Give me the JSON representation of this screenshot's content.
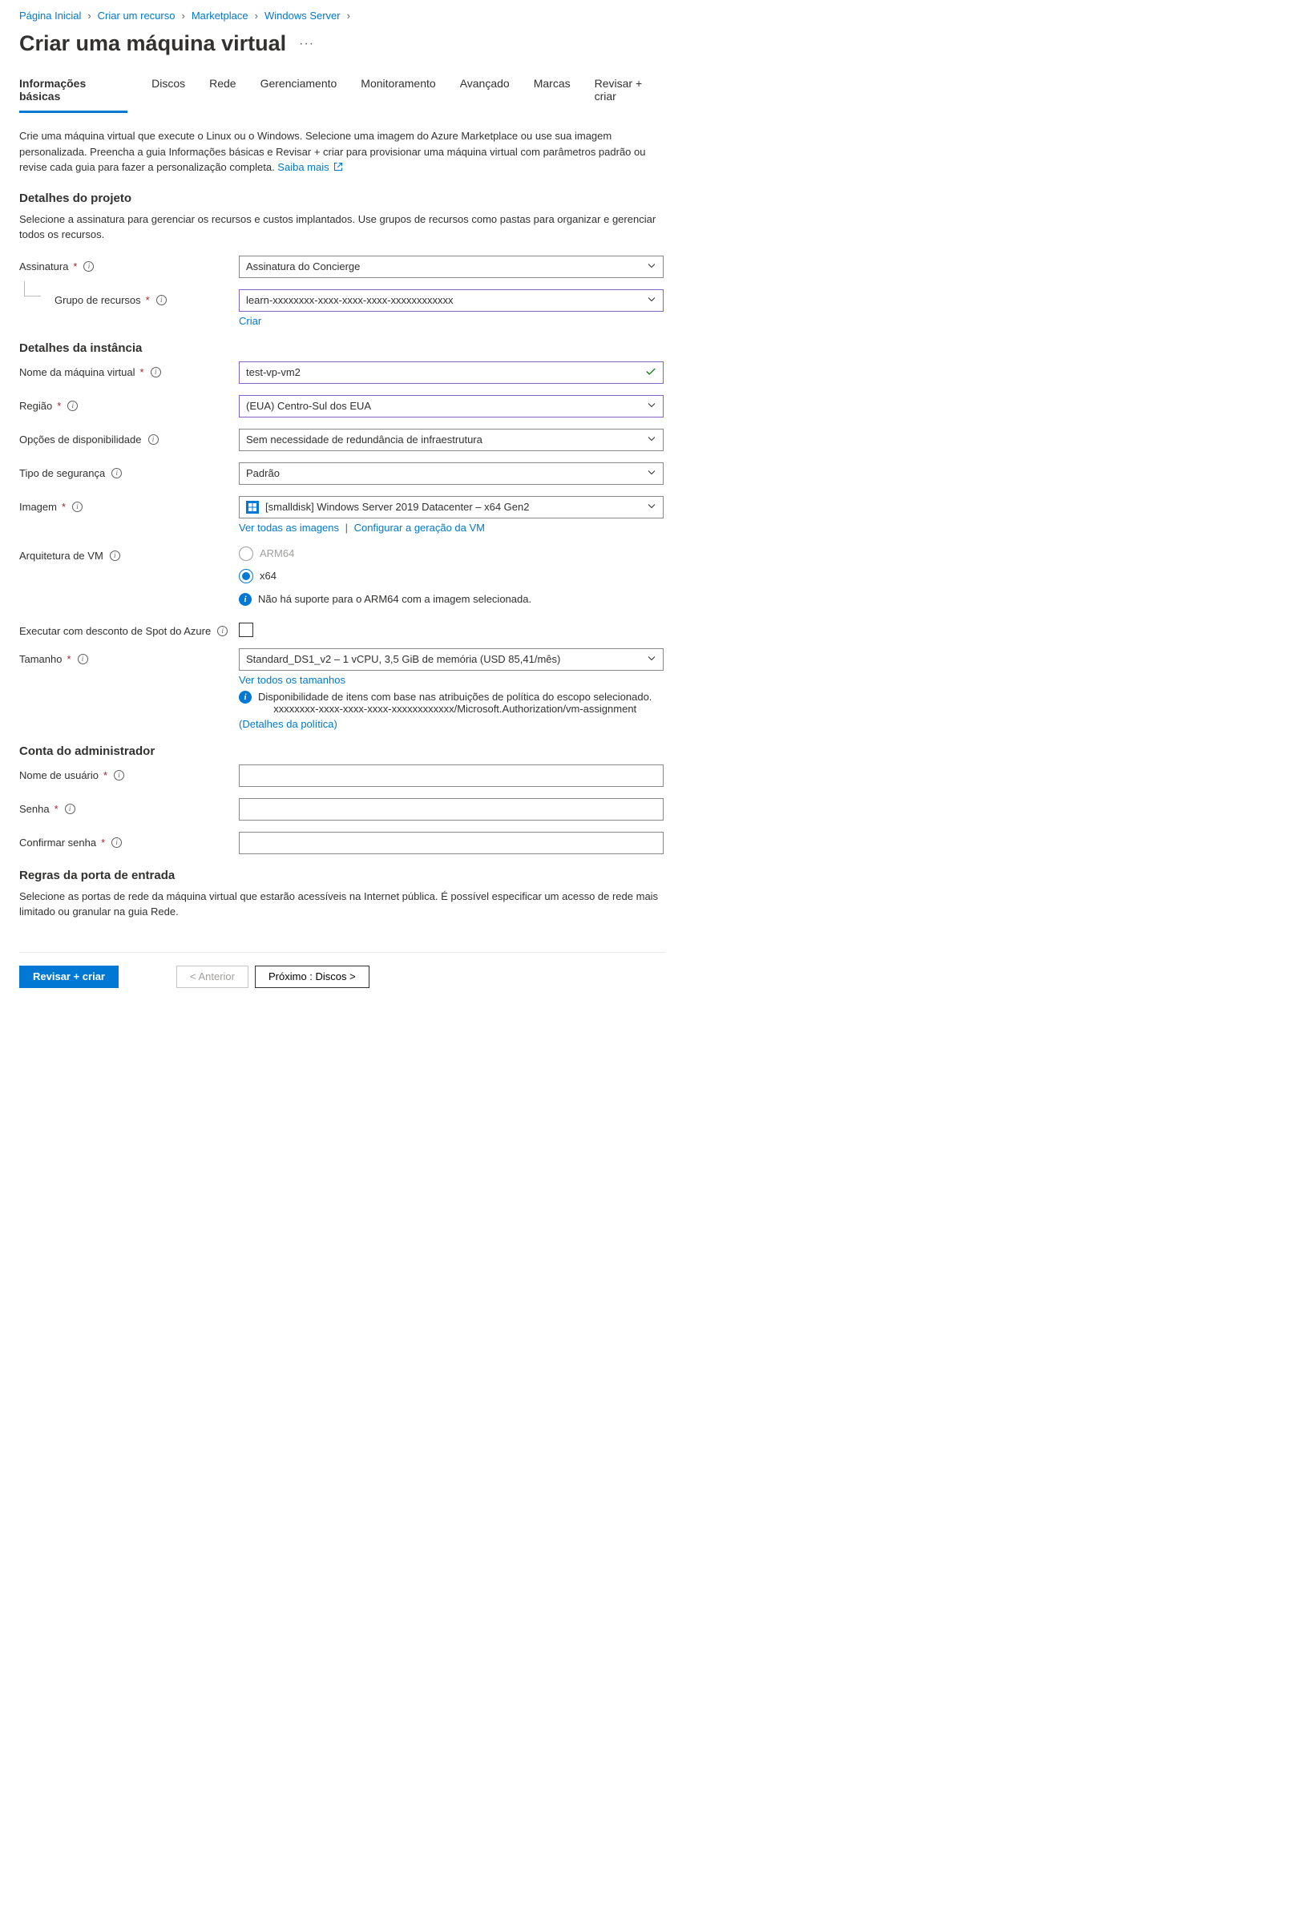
{
  "breadcrumbs": {
    "home": "Página Inicial",
    "create": "Criar um recurso",
    "marketplace": "Marketplace",
    "windows": "Windows Server"
  },
  "title": "Criar uma máquina virtual",
  "tabs": {
    "basics": "Informações básicas",
    "disks": "Discos",
    "network": "Rede",
    "mgmt": "Gerenciamento",
    "monitor": "Monitoramento",
    "advanced": "Avançado",
    "tags": "Marcas",
    "review": "Revisar + criar"
  },
  "intro": "Crie uma máquina virtual que execute o Linux ou o Windows. Selecione uma imagem do Azure Marketplace ou use sua imagem personalizada. Preencha a guia Informações básicas e Revisar + criar para provisionar uma máquina virtual com parâmetros padrão ou revise cada guia para fazer a personalização completa. ",
  "learn_more": "Saiba mais",
  "project": {
    "heading": "Detalhes do projeto",
    "desc": "Selecione a assinatura para gerenciar os recursos e custos implantados. Use grupos de recursos como pastas para organizar e gerenciar todos os recursos.",
    "subscription_label": "Assinatura",
    "subscription_value": "Assinatura do Concierge",
    "rg_label": "Grupo de recursos",
    "rg_value": "learn-xxxxxxxx-xxxx-xxxx-xxxx-xxxxxxxxxxxx",
    "rg_create": "Criar"
  },
  "instance": {
    "heading": "Detalhes da instância",
    "vm_name_label": "Nome da máquina virtual",
    "vm_name_value": "test-vp-vm2",
    "region_label": "Região",
    "region_value": "(EUA) Centro-Sul dos EUA",
    "avail_label": "Opções de disponibilidade",
    "avail_value": "Sem necessidade de redundância de infraestrutura",
    "sectype_label": "Tipo de segurança",
    "sectype_value": "Padrão",
    "image_label": "Imagem",
    "image_value": "[smalldisk] Windows Server 2019 Datacenter – x64 Gen2",
    "image_link_all": "Ver todas as imagens",
    "image_link_gen": "Configurar a geração da VM",
    "arch_label": "Arquitetura de VM",
    "arch_arm64": "ARM64",
    "arch_x64": "x64",
    "arch_note": "Não há suporte para o ARM64 com a imagem selecionada.",
    "spot_label": "Executar com desconto de Spot do Azure",
    "size_label": "Tamanho",
    "size_value": "Standard_DS1_v2 – 1 vCPU, 3,5 GiB de memória (USD 85,41/mês)",
    "size_link": "Ver todos os tamanhos",
    "size_note1": "Disponibilidade de itens com base nas atribuições de política do escopo selecionado.",
    "size_note2": "xxxxxxxx-xxxx-xxxx-xxxx-xxxxxxxxxxxx/Microsoft.Authorization/vm-assignment",
    "size_policy": "(Detalhes da política)"
  },
  "admin": {
    "heading": "Conta do administrador",
    "user_label": "Nome de usuário",
    "pass_label": "Senha",
    "confirm_label": "Confirmar senha"
  },
  "ports": {
    "heading": "Regras da porta de entrada",
    "desc": "Selecione as portas de rede da máquina virtual que estarão acessíveis na Internet pública. É possível especificar um acesso de rede mais limitado ou granular na guia Rede."
  },
  "footer": {
    "review": "Revisar + criar",
    "prev": "< Anterior",
    "next": "Próximo : Discos  >"
  }
}
